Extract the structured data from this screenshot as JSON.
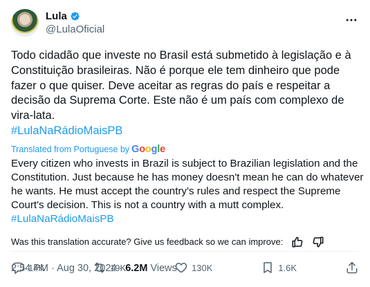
{
  "author": {
    "name": "Lula",
    "handle": "@LulaOficial"
  },
  "tweet": {
    "original_text": "Todo cidadão que investe no Brasil está submetido à legislação e à Constituição brasileiras. Não é porque ele tem dinheiro que pode fazer o que quiser. Deve aceitar as regras do país e respeitar a decisão da Suprema Corte. Este não é um país com complexo de vira-lata.",
    "hashtag": "#LulaNaRádioMaisPB",
    "translated_from": "Translated from Portuguese by",
    "translator": "Google",
    "translation_text": "Every citizen who invests in Brazil is subject to Brazilian legislation and the Constitution. Just because he has money doesn't mean he can do whatever he wants. He must accept the country's rules and respect the Supreme Court's decision. This is not a country with a mutt complex.",
    "translation_hashtag": "#LulaNaRádioMaisPB",
    "feedback_prompt": "Was this translation accurate? Give us feedback so we can improve:",
    "timestamp": "2:54 PM · Aug 30, 2024 ·",
    "views_count": "6.2M",
    "views_label": "Views"
  },
  "actions": {
    "replies": "14K",
    "retweets": "19K",
    "likes": "130K",
    "bookmarks": "1.6K"
  },
  "icons": {
    "verified": "verified-badge-icon",
    "more": "more-options-icon",
    "reply": "reply-icon",
    "retweet": "retweet-icon",
    "like": "heart-icon",
    "bookmark": "bookmark-icon",
    "share": "share-icon",
    "thumbs_up": "thumbs-up-icon",
    "thumbs_down": "thumbs-down-icon"
  },
  "colors": {
    "link": "#1d9bf0",
    "secondary_text": "#536471",
    "primary_text": "#0f1419",
    "verified": "#1d9bf0"
  }
}
